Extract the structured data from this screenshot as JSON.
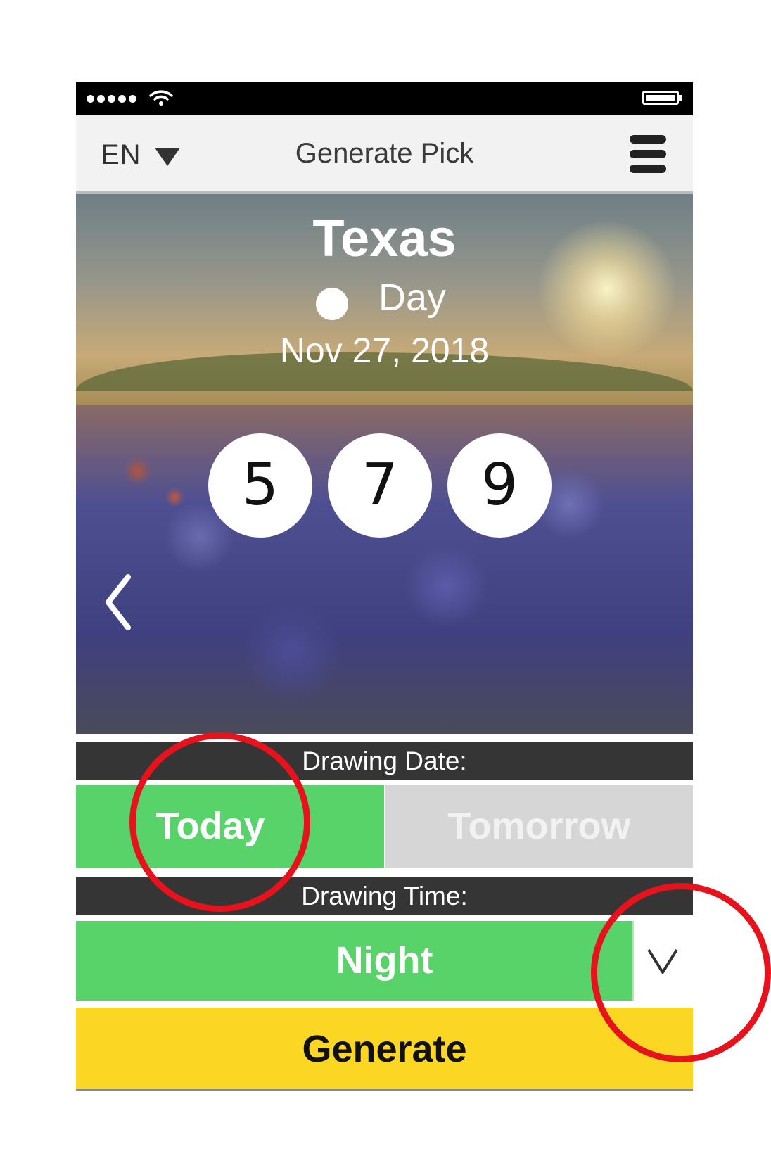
{
  "status_bar": {
    "signal_icon": "signal-dots-icon",
    "wifi_icon": "wifi-icon",
    "battery_icon": "battery-icon"
  },
  "navbar": {
    "language": "EN",
    "title": "Generate Pick",
    "menu_icon": "hamburger-menu-icon"
  },
  "hero": {
    "state": "Texas",
    "period": "Day",
    "date": "Nov 27, 2018",
    "numbers": [
      "5",
      "7",
      "9"
    ],
    "prev_icon": "chevron-left-icon"
  },
  "drawing_date": {
    "label": "Drawing Date:",
    "options": [
      "Today",
      "Tomorrow"
    ],
    "selected": "Today"
  },
  "drawing_time": {
    "label": "Drawing Time:",
    "selected": "Night",
    "dropdown_icon": "chevron-down-icon"
  },
  "generate_label": "Generate",
  "colors": {
    "selected_green": "#58d36a",
    "unselected_gray": "#d6d6d6",
    "header_bar": "#353535",
    "generate_yellow": "#fbd724",
    "annotation_red": "#e8121d"
  }
}
